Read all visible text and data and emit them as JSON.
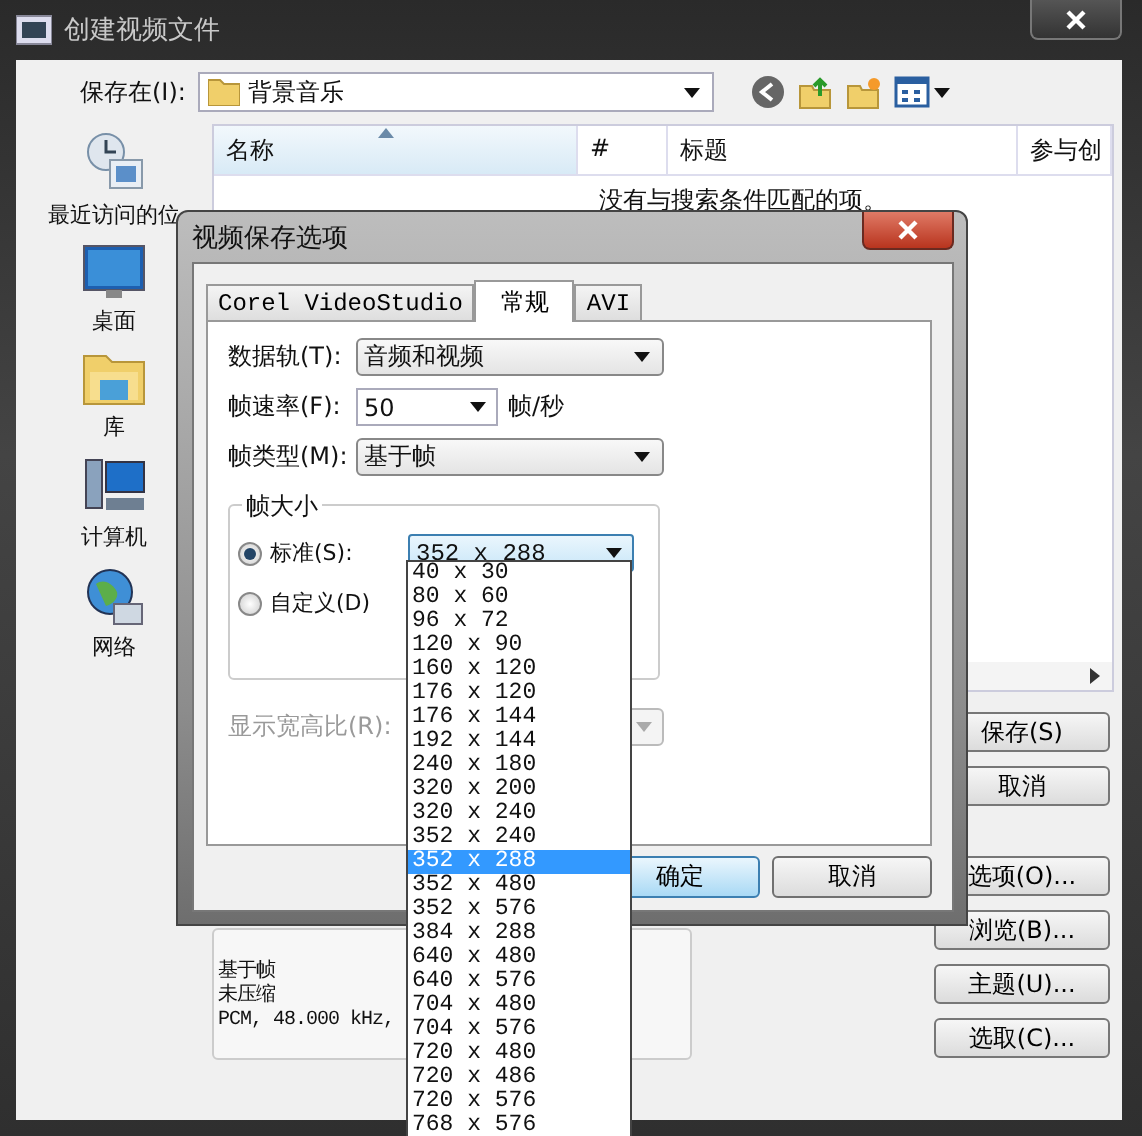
{
  "window": {
    "title": "创建视频文件"
  },
  "save_in": {
    "label": "保存在(I):",
    "value": "背景音乐"
  },
  "places": [
    {
      "label": "最近访问的位"
    },
    {
      "label": "桌面"
    },
    {
      "label": "库"
    },
    {
      "label": "计算机"
    },
    {
      "label": "网络"
    }
  ],
  "file_list": {
    "columns": [
      {
        "label": "名称",
        "sorted": true
      },
      {
        "label": "#",
        "sorted": false
      },
      {
        "label": "标题",
        "sorted": false
      },
      {
        "label": "参与创",
        "sorted": false
      }
    ],
    "empty_message": "没有与搜索条件匹配的项。"
  },
  "info_lines": [
    "基于帧",
    "未压缩",
    "PCM, 48.000 kHz,"
  ],
  "buttons": [
    {
      "label": "保存(S)"
    },
    {
      "label": "取消"
    },
    {
      "label": "选项(O)..."
    },
    {
      "label": "浏览(B)..."
    },
    {
      "label": "主题(U)..."
    },
    {
      "label": "选取(C)..."
    }
  ],
  "options_dialog": {
    "title": "视频保存选项",
    "tabs": [
      {
        "label": "Corel VideoStudio",
        "selected": false
      },
      {
        "label": "常规",
        "selected": true
      },
      {
        "label": "AVI",
        "selected": false
      }
    ],
    "data_track": {
      "label": "数据轨(T):",
      "value": "音频和视频"
    },
    "frame_rate": {
      "label": "帧速率(F):",
      "value": "50",
      "unit": "帧/秒"
    },
    "frame_type": {
      "label": "帧类型(M):",
      "value": "基于帧"
    },
    "frame_size": {
      "legend": "帧大小",
      "options": [
        {
          "label": "标准(S):",
          "selected": true
        },
        {
          "label": "自定义(D)",
          "selected": false
        }
      ],
      "value": "352 x 288"
    },
    "aspect_ratio": {
      "label": "显示宽高比(R):",
      "disabled": true
    },
    "buttons": [
      {
        "label": "确定",
        "default": true
      },
      {
        "label": "取消",
        "default": false
      }
    ]
  },
  "size_list": [
    {
      "label": "40 x 30",
      "selected": false
    },
    {
      "label": "80 x 60",
      "selected": false
    },
    {
      "label": "96 x 72",
      "selected": false
    },
    {
      "label": "120 x 90",
      "selected": false
    },
    {
      "label": "160 x 120",
      "selected": false
    },
    {
      "label": "176 x 120",
      "selected": false
    },
    {
      "label": "176 x 144",
      "selected": false
    },
    {
      "label": "192 x 144",
      "selected": false
    },
    {
      "label": "240 x 180",
      "selected": false
    },
    {
      "label": "320 x 200",
      "selected": false
    },
    {
      "label": "320 x 240",
      "selected": false
    },
    {
      "label": "352 x 240",
      "selected": false
    },
    {
      "label": "352 x 288",
      "selected": true
    },
    {
      "label": "352 x 480",
      "selected": false
    },
    {
      "label": "352 x 576",
      "selected": false
    },
    {
      "label": "384 x 288",
      "selected": false
    },
    {
      "label": "640 x 480",
      "selected": false
    },
    {
      "label": "640 x 576",
      "selected": false
    },
    {
      "label": "704 x 480",
      "selected": false
    },
    {
      "label": "704 x 576",
      "selected": false
    },
    {
      "label": "720 x 480",
      "selected": false
    },
    {
      "label": "720 x 486",
      "selected": false
    },
    {
      "label": "720 x 576",
      "selected": false
    },
    {
      "label": "768 x 576",
      "selected": false
    }
  ]
}
